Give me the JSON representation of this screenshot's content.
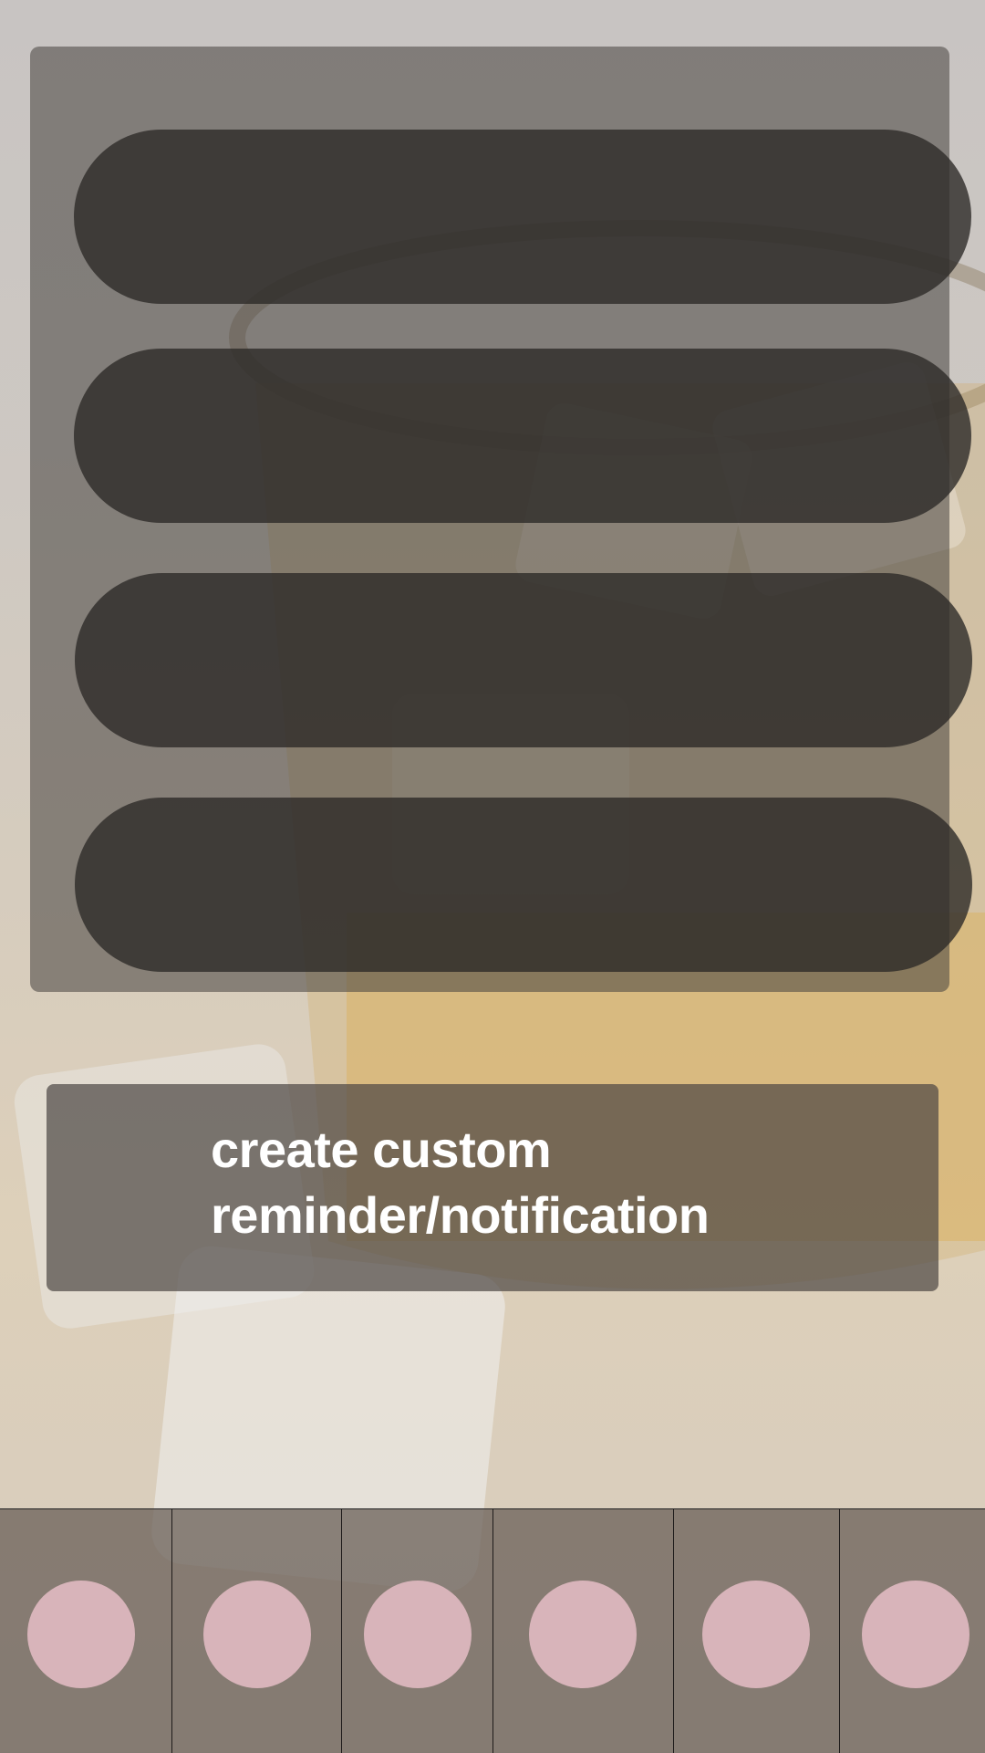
{
  "background": {
    "description_icon": "whisky-glass-photo"
  },
  "reminders": [
    {
      "label": ""
    },
    {
      "label": ""
    },
    {
      "label": ""
    },
    {
      "label": ""
    }
  ],
  "create_button": {
    "line1": "create custom",
    "line2": "reminder/notification"
  },
  "tabs": [
    {
      "icon": "circle-icon"
    },
    {
      "icon": "circle-icon"
    },
    {
      "icon": "circle-icon"
    },
    {
      "icon": "circle-icon"
    },
    {
      "icon": "circle-icon"
    },
    {
      "icon": "circle-icon"
    }
  ],
  "colors": {
    "tab_icon": "#d8b4ba",
    "panel": "#46413e",
    "pill": "#2d2a28"
  }
}
